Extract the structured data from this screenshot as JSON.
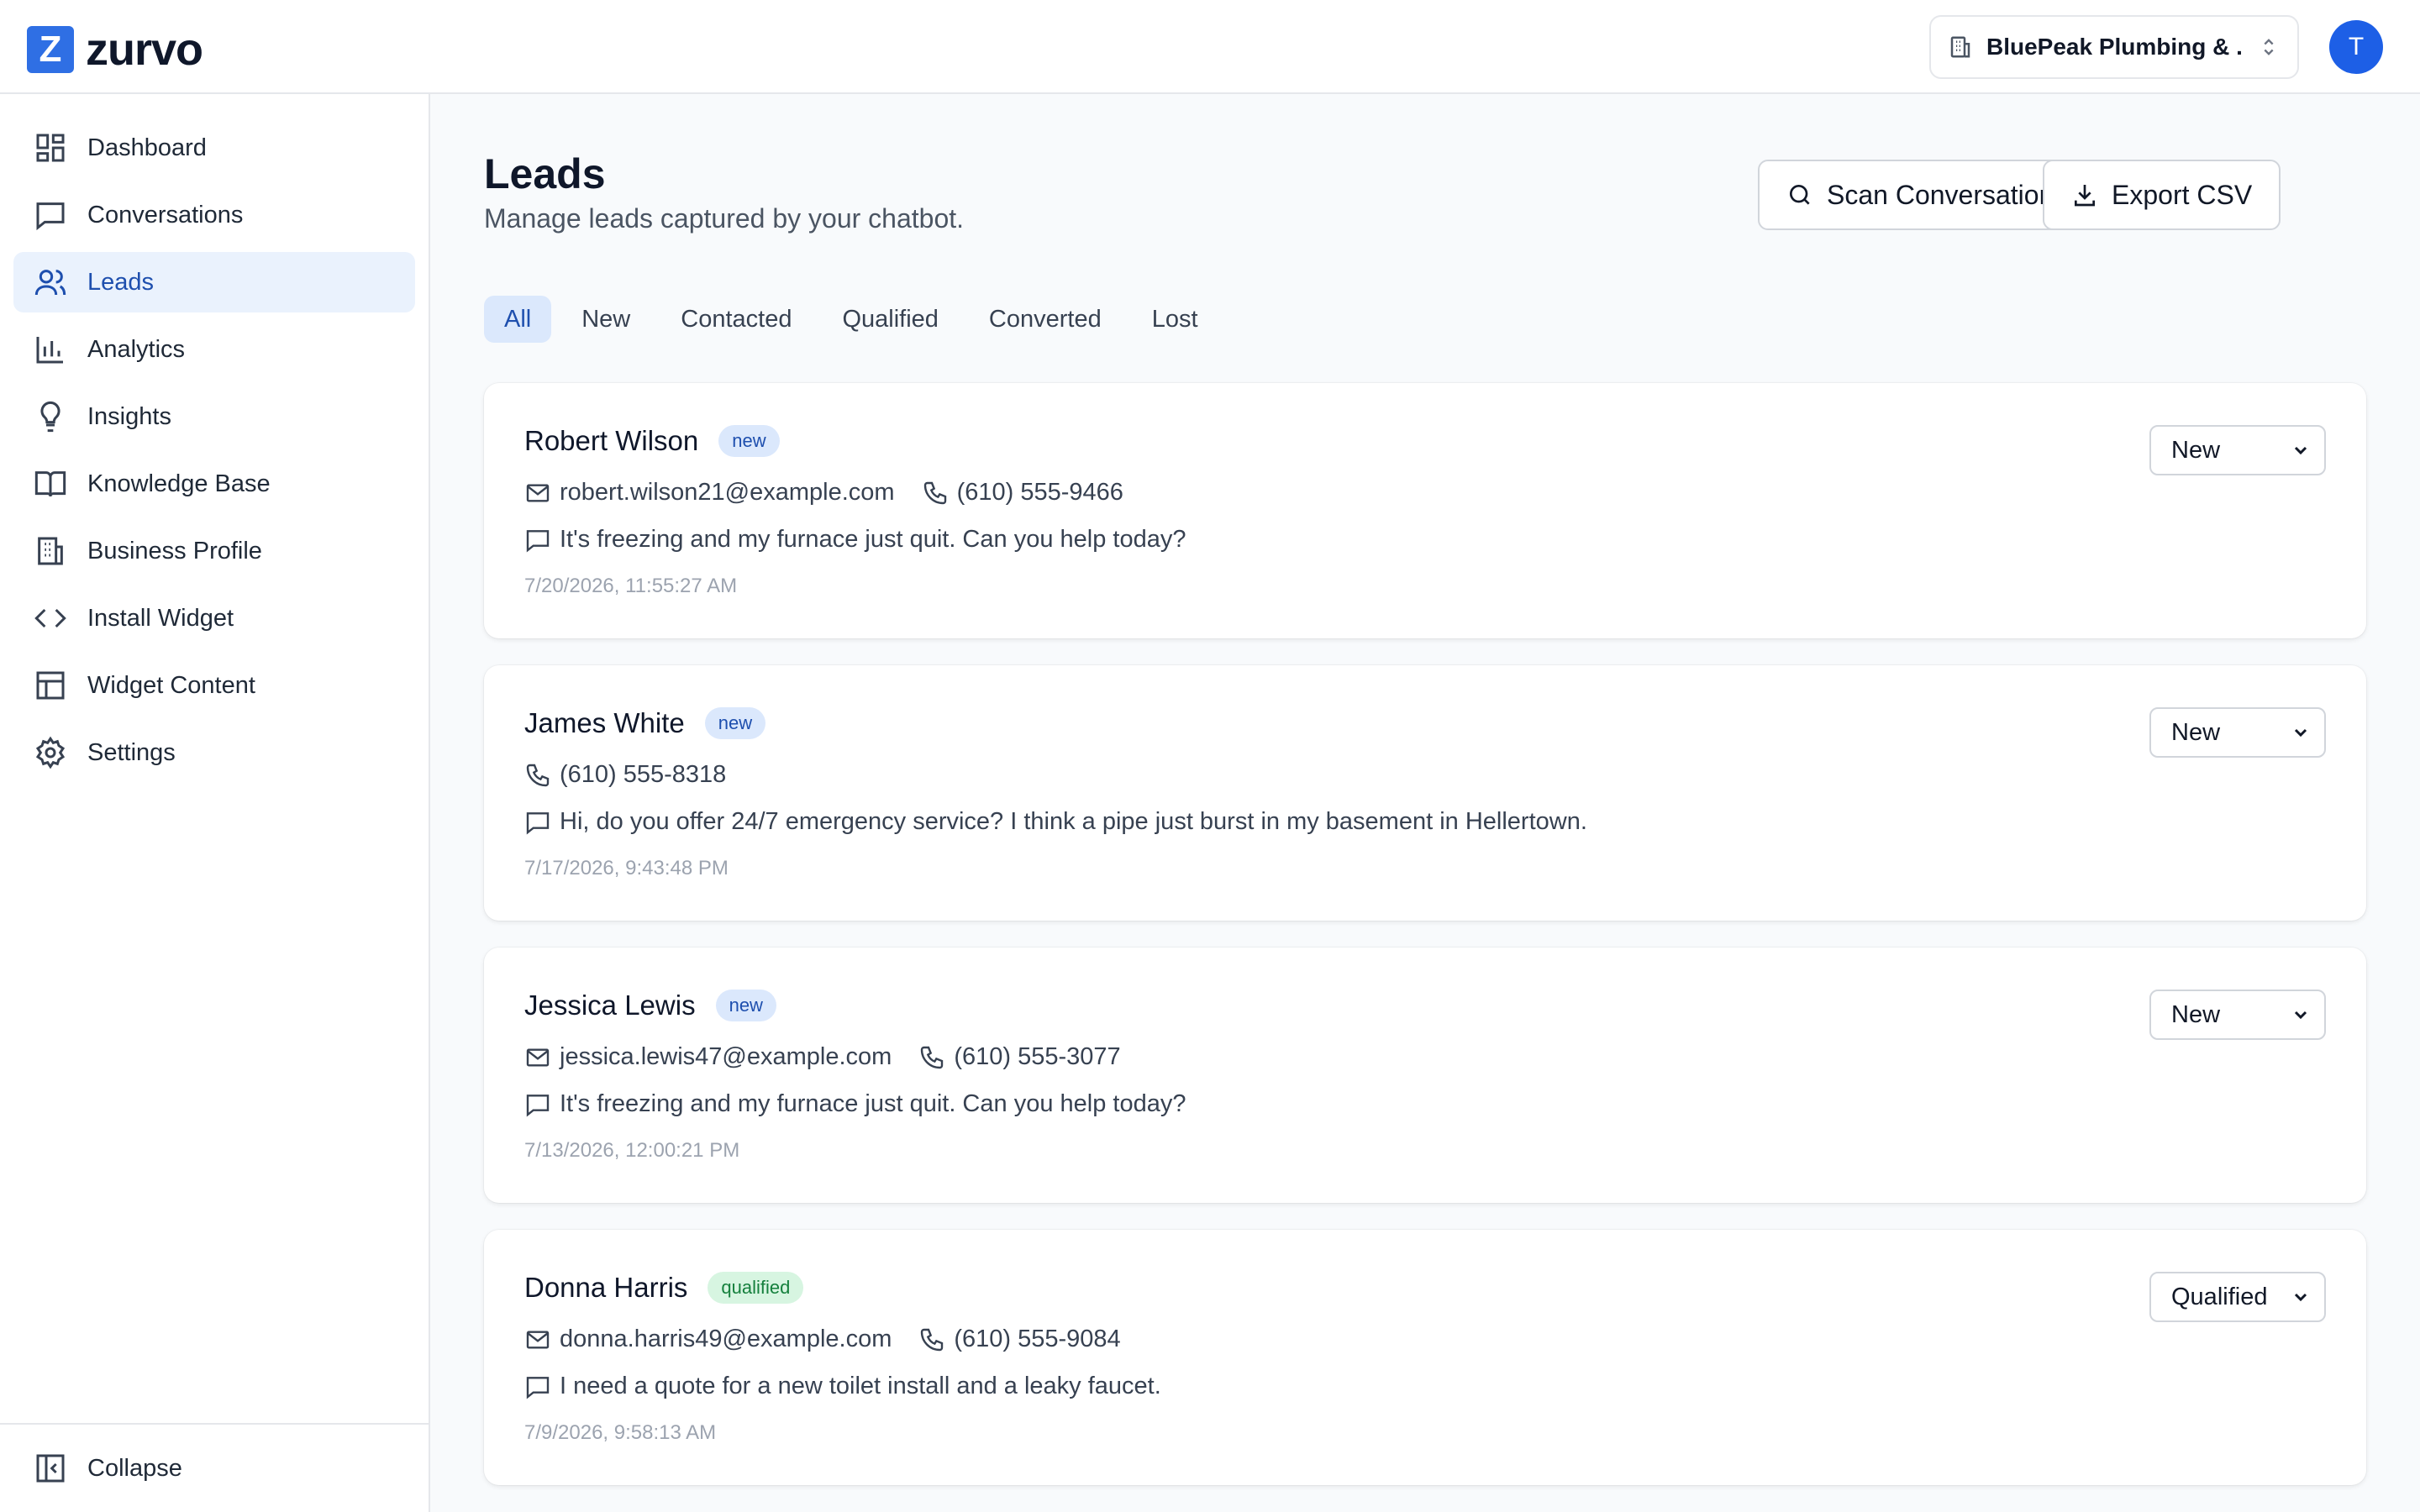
{
  "app": {
    "name": "zurvo",
    "logo_letter": "Z"
  },
  "header": {
    "business_selector": "BluePeak Plumbing & ...",
    "avatar_initial": "T"
  },
  "sidebar": {
    "items": [
      {
        "label": "Dashboard",
        "icon": "dashboard-icon"
      },
      {
        "label": "Conversations",
        "icon": "message-square-icon"
      },
      {
        "label": "Leads",
        "icon": "users-icon",
        "active": true
      },
      {
        "label": "Analytics",
        "icon": "bar-chart-icon"
      },
      {
        "label": "Insights",
        "icon": "lightbulb-icon"
      },
      {
        "label": "Knowledge Base",
        "icon": "book-icon"
      },
      {
        "label": "Business Profile",
        "icon": "building-icon"
      },
      {
        "label": "Install Widget",
        "icon": "code-icon"
      },
      {
        "label": "Widget Content",
        "icon": "layout-icon"
      },
      {
        "label": "Settings",
        "icon": "gear-icon"
      }
    ],
    "collapse_label": "Collapse"
  },
  "page": {
    "title": "Leads",
    "subtitle": "Manage leads captured by your chatbot.",
    "scan_button": "Scan Conversations",
    "export_button": "Export CSV"
  },
  "tabs": [
    {
      "label": "All",
      "active": true
    },
    {
      "label": "New"
    },
    {
      "label": "Contacted"
    },
    {
      "label": "Qualified"
    },
    {
      "label": "Converted"
    },
    {
      "label": "Lost"
    }
  ],
  "leads": [
    {
      "name": "Robert Wilson",
      "badge": "new",
      "email": "robert.wilson21@example.com",
      "phone": "(610) 555-9466",
      "message": "It's freezing and my furnace just quit. Can you help today?",
      "timestamp": "7/20/2026, 11:55:27 AM",
      "status": "New"
    },
    {
      "name": "James White",
      "badge": "new",
      "email": "",
      "phone": "(610) 555-8318",
      "message": "Hi, do you offer 24/7 emergency service? I think a pipe just burst in my basement in Hellertown.",
      "timestamp": "7/17/2026, 9:43:48 PM",
      "status": "New"
    },
    {
      "name": "Jessica Lewis",
      "badge": "new",
      "email": "jessica.lewis47@example.com",
      "phone": "(610) 555-3077",
      "message": "It's freezing and my furnace just quit. Can you help today?",
      "timestamp": "7/13/2026, 12:00:21 PM",
      "status": "New"
    },
    {
      "name": "Donna Harris",
      "badge": "qualified",
      "email": "donna.harris49@example.com",
      "phone": "(610) 555-9084",
      "message": "I need a quote for a new toilet install and a leaky faucet.",
      "timestamp": "7/9/2026, 9:58:13 AM",
      "status": "Qualified"
    }
  ],
  "colors": {
    "brand": "#2f6fe4",
    "active_bg": "#eaf2fd",
    "qualified_badge": "#d7f5e1"
  }
}
